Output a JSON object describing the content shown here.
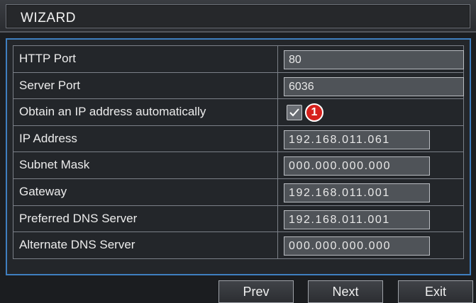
{
  "window": {
    "title": "WIZARD"
  },
  "settings": {
    "rows": [
      {
        "label": "HTTP Port",
        "value": "80"
      },
      {
        "label": "Server Port",
        "value": "6036"
      },
      {
        "label": "Obtain an IP address automatically",
        "checked": true,
        "callout": "1"
      },
      {
        "label": "IP Address",
        "value": "192.168.011.061"
      },
      {
        "label": "Subnet Mask",
        "value": "000.000.000.000"
      },
      {
        "label": "Gateway",
        "value": "192.168.011.001"
      },
      {
        "label": "Preferred DNS Server",
        "value": "192.168.011.001"
      },
      {
        "label": "Alternate DNS Server",
        "value": "000.000.000.000"
      }
    ]
  },
  "buttons": {
    "prev": "Prev",
    "next": "Next",
    "exit": "Exit"
  },
  "colors": {
    "panel_border": "#3f7fc0",
    "callout": "#d6201c"
  }
}
